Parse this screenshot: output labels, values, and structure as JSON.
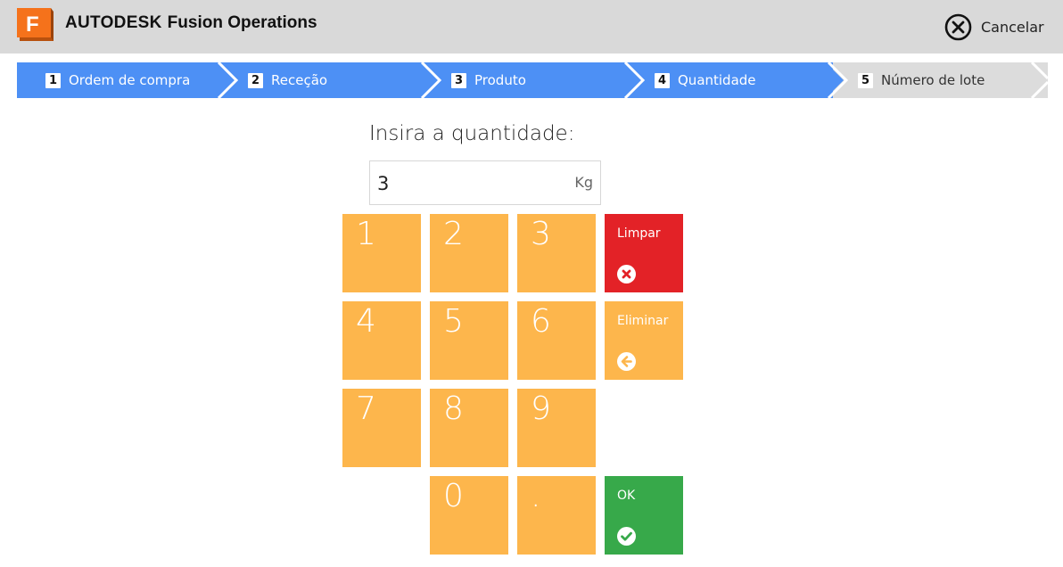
{
  "header": {
    "brand_bold": "AUTODESK",
    "brand_product": "Fusion Operations",
    "logo_letter": "F",
    "cancel_label": "Cancelar"
  },
  "steps": [
    {
      "number": "1",
      "label": "Ordem de compra",
      "state": "done"
    },
    {
      "number": "2",
      "label": "Receção",
      "state": "done"
    },
    {
      "number": "3",
      "label": "Produto",
      "state": "done"
    },
    {
      "number": "4",
      "label": "Quantidade",
      "state": "active"
    },
    {
      "number": "5",
      "label": "Número de lote",
      "state": "pending"
    }
  ],
  "prompt": "Insira a quantidade:",
  "quantity": {
    "value": "3",
    "unit": "Kg"
  },
  "keypad": {
    "digits": [
      "1",
      "2",
      "3",
      "4",
      "5",
      "6",
      "7",
      "8",
      "9",
      "0",
      "."
    ],
    "clear_label": "Limpar",
    "delete_label": "Eliminar",
    "ok_label": "OK"
  },
  "colors": {
    "header_bg": "#d9d9d9",
    "step_active": "#4d90f5",
    "step_inactive": "#dcdcdc",
    "key": "#fdb64c",
    "clear": "#e32227",
    "ok": "#37a94a"
  }
}
